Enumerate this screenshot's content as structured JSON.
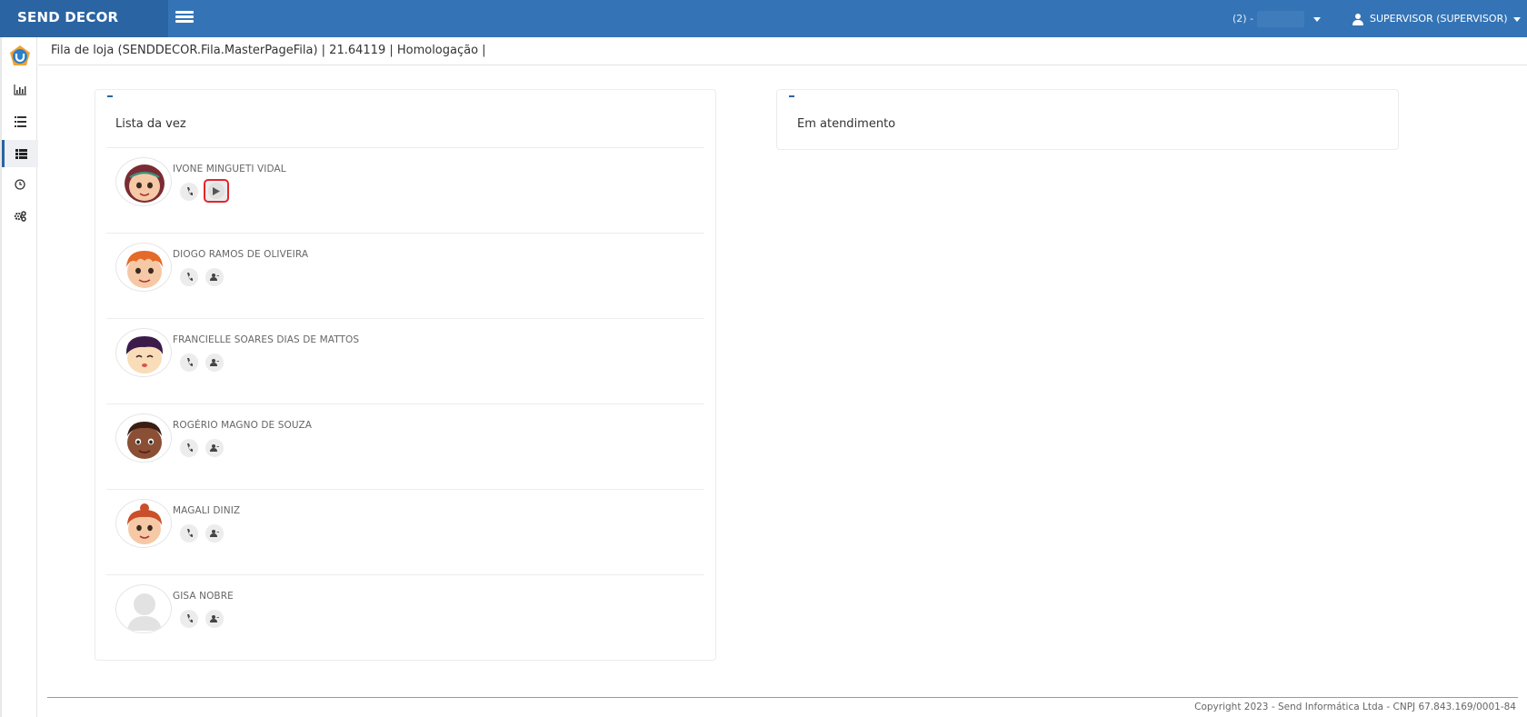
{
  "app": {
    "brand": "SEND DECOR"
  },
  "topbar": {
    "store_label": "(2) -",
    "user_label": "SUPERVISOR (SUPERVISOR)"
  },
  "sidebar": {
    "items": [
      {
        "name": "dashboard",
        "icon": "bar-chart-icon"
      },
      {
        "name": "list",
        "icon": "list-icon"
      },
      {
        "name": "queue",
        "icon": "queue-list-icon",
        "active": true
      },
      {
        "name": "history",
        "icon": "clock-icon"
      },
      {
        "name": "settings",
        "icon": "gears-icon"
      }
    ]
  },
  "header": {
    "title": "Fila de loja (SENDDECOR.Fila.MasterPageFila) | 21.64119 | Homologação |"
  },
  "left_panel": {
    "title": "Lista da vez",
    "people": [
      {
        "name": "IVONE MINGUETI VIDAL",
        "avatar": "girl-brown-hair",
        "second_action": "play"
      },
      {
        "name": "DIOGO RAMOS DE OLIVEIRA",
        "avatar": "boy-red-hair",
        "second_action": "user-add"
      },
      {
        "name": "FRANCIELLE SOARES DIAS DE MATTOS",
        "avatar": "girl-purple-hair",
        "second_action": "user-add"
      },
      {
        "name": "ROGÉRIO MAGNO DE SOUZA",
        "avatar": "boy-dark-skin",
        "second_action": "user-add"
      },
      {
        "name": "MAGALI DINIZ",
        "avatar": "girl-red-bun",
        "second_action": "user-add"
      },
      {
        "name": "GISA NOBRE",
        "avatar": "placeholder-silhouette",
        "second_action": "user-add"
      }
    ]
  },
  "right_panel": {
    "title": "Em atendimento"
  },
  "footer": {
    "copyright": "Copyright 2023 - Send Informática Ltda - CNPJ 67.843.169/0001-84"
  },
  "colors": {
    "topbar": "#3474b6",
    "brand_bg": "#2a64a3",
    "highlight": "#e2262c"
  }
}
